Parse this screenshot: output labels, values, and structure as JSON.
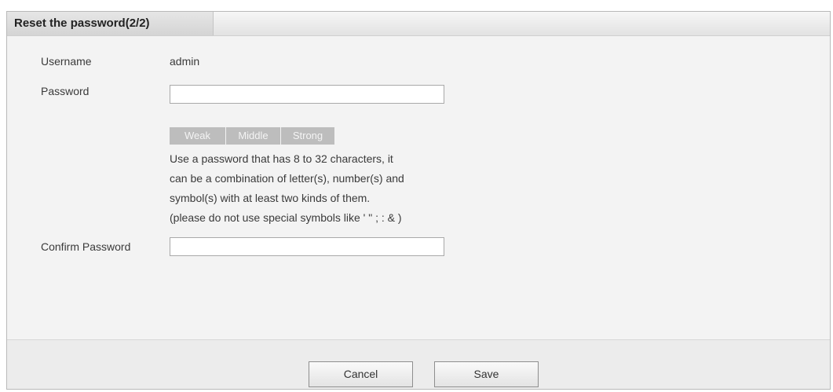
{
  "dialog": {
    "title": "Reset the password(2/2)"
  },
  "form": {
    "username_label": "Username",
    "username_value": "admin",
    "password_label": "Password",
    "password_value": "",
    "confirm_label": "Confirm Password",
    "confirm_value": ""
  },
  "strength": {
    "weak": "Weak",
    "middle": "Middle",
    "strong": "Strong"
  },
  "hint": {
    "lines": [
      "Use a password that has 8 to 32 characters, it",
      "can be a combination of letter(s), number(s) and",
      "symbol(s) with at least two kinds of them.",
      "(please do not use special symbols like ' \" ; : & )"
    ]
  },
  "buttons": {
    "cancel": "Cancel",
    "save": "Save"
  },
  "colors": {
    "panel_background": "#f3f3f3",
    "strength_inactive": "#bdbdbd",
    "header_gradient_top": "#f6f6f6",
    "header_gradient_bottom": "#e2e2e2"
  }
}
